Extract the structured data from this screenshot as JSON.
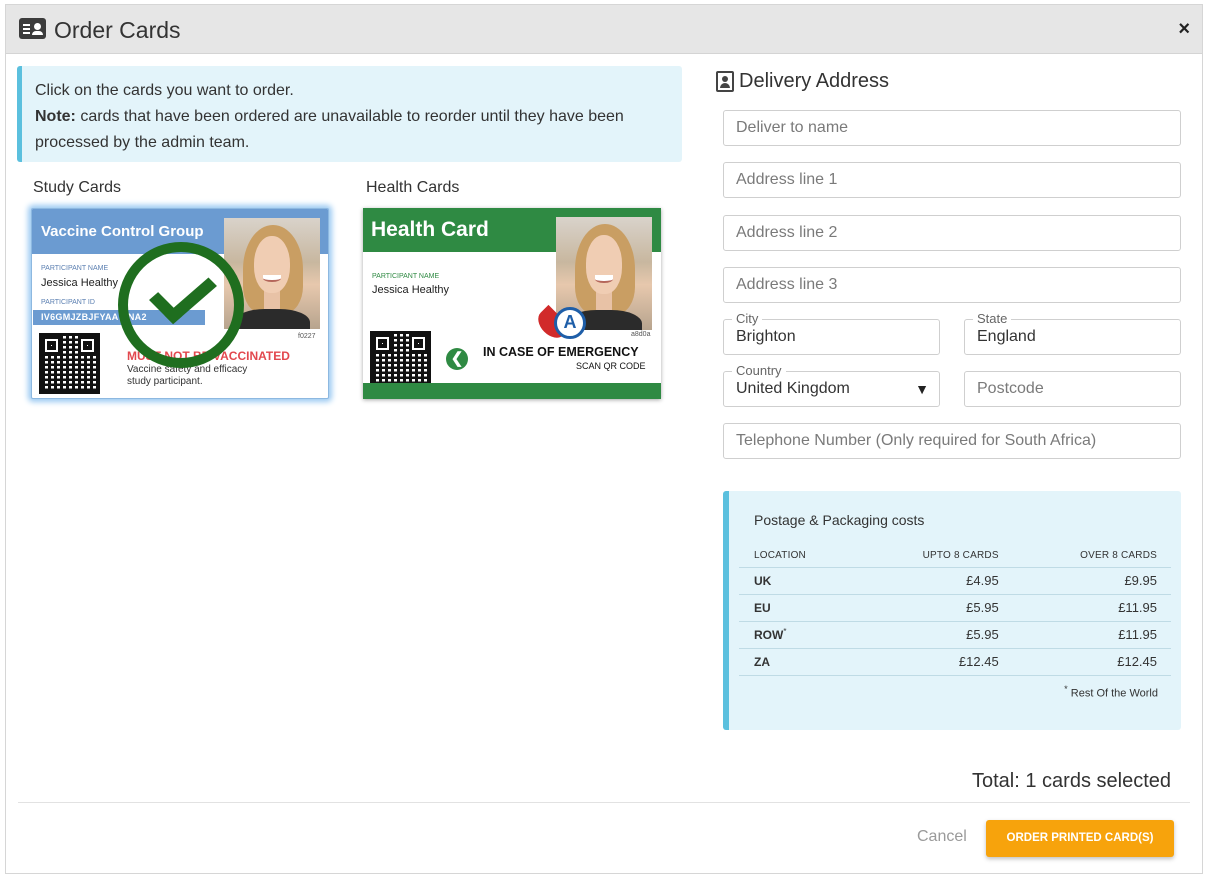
{
  "modal": {
    "title": "Order Cards",
    "close": "×"
  },
  "info": {
    "line1": "Click on the cards you want to order.",
    "note_label": "Note:",
    "note_text": " cards that have been ordered are unavailable to reorder until they have been processed by the admin team."
  },
  "sections": {
    "study": "Study Cards",
    "health": "Health Cards"
  },
  "study_card": {
    "title": "Vaccine Control Group",
    "name_label": "Participant Name",
    "name": "Jessica Healthy",
    "id_label": "Participant ID",
    "id": "IV6GMJZBJFYAA  KNA2",
    "code": "f0227",
    "warning": "MUST NOT BE VACCINATED",
    "desc1": "Vaccine safety and efficacy",
    "desc2": "study participant.",
    "selected": true
  },
  "health_card": {
    "title": "Health Card",
    "name_label": "Participant Name",
    "name": "Jessica Healthy",
    "blood_group": "A",
    "code": "a8d0a",
    "emergency": "IN CASE OF EMERGENCY",
    "scan": "SCAN QR CODE",
    "selected": false
  },
  "delivery": {
    "title": "Delivery Address",
    "fields": {
      "name_placeholder": "Deliver to name",
      "addr1_placeholder": "Address line 1",
      "addr2_placeholder": "Address line 2",
      "addr3_placeholder": "Address line 3",
      "city_label": "City",
      "city_value": "Brighton",
      "state_label": "State",
      "state_value": "England",
      "country_label": "Country",
      "country_value": "United Kingdom",
      "postcode_placeholder": "Postcode",
      "phone_placeholder": "Telephone Number (Only required for South Africa)"
    }
  },
  "costs": {
    "title": "Postage & Packaging costs",
    "headers": [
      "Location",
      "upto 8 cards",
      "over 8 cards"
    ],
    "rows": [
      {
        "loc": "UK",
        "sup": "",
        "upto": "£4.95",
        "over": "£9.95"
      },
      {
        "loc": "EU",
        "sup": "",
        "upto": "£5.95",
        "over": "£11.95"
      },
      {
        "loc": "ROW",
        "sup": "*",
        "upto": "£5.95",
        "over": "£11.95"
      },
      {
        "loc": "ZA",
        "sup": "",
        "upto": "£12.45",
        "over": "£12.45"
      }
    ],
    "footnote_mark": "*",
    "footnote": " Rest Of the World"
  },
  "footer": {
    "total": "Total: 1 cards selected",
    "cancel": "Cancel",
    "order": "ORDER PRINTED CARD(S)"
  },
  "colors": {
    "accent_info": "#5bc0de",
    "study_blue": "#6b9bd1",
    "health_green": "#2f8a43",
    "check_green": "#1f6e1f",
    "order_orange": "#f7a30c"
  }
}
